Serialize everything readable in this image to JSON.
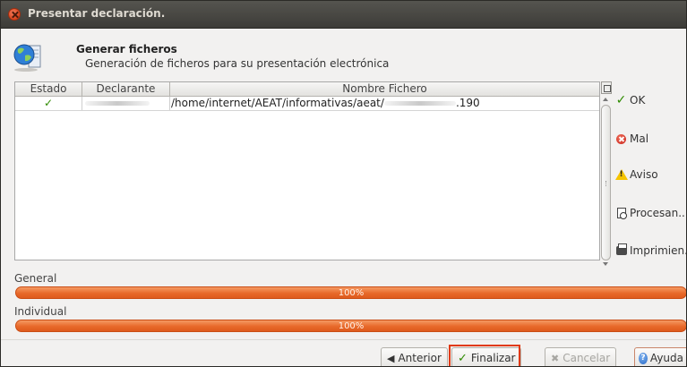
{
  "window": {
    "title": "Presentar declaración."
  },
  "header": {
    "title": "Generar ficheros",
    "subtitle": "Generación de ficheros para su presentación electrónica",
    "icon": "globe-document-icon"
  },
  "table": {
    "columns": [
      "Estado",
      "Declarante",
      "Nombre Fichero"
    ],
    "rows": [
      {
        "estado": "✓",
        "declarante": "",
        "path": "/home/internet/AEAT/informativas/aeat/",
        "ext": ".190"
      }
    ]
  },
  "side_panel": {
    "items": [
      {
        "label": "OK",
        "icon": "check-icon"
      },
      {
        "label": "Mal",
        "icon": "error-icon"
      },
      {
        "label": "Aviso",
        "icon": "warning-icon"
      },
      {
        "label": "Procesan...",
        "icon": "processing-document-icon"
      },
      {
        "label": "Imprimien...",
        "icon": "printer-icon"
      }
    ]
  },
  "progress": {
    "general": {
      "label": "General",
      "text": "100%",
      "value": 1.0
    },
    "individual": {
      "label": "Individual",
      "text": "100%",
      "value": 1.0
    }
  },
  "buttons": {
    "anterior": "Anterior",
    "finalizar": "Finalizar",
    "cancelar": "Cancelar",
    "ayuda": "Ayuda"
  },
  "colors": {
    "progress": "#e8692a",
    "check": "#2e8b00",
    "highlight": "#e03a12"
  }
}
